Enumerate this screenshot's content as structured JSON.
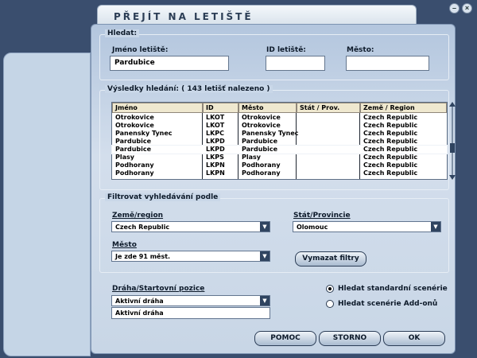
{
  "window": {
    "title": "PŘEJÍT NA LETIŠTĚ",
    "minimize": "–",
    "close": "×"
  },
  "search": {
    "group_title": "Hledat:",
    "airport_name_label": "Jméno letiště:",
    "airport_name_value": "Pardubice",
    "airport_id_label": "ID letiště:",
    "airport_id_value": "",
    "city_label": "Město:",
    "city_value": ""
  },
  "results": {
    "group_title": "Výsledky hledání: ( 143 letišť nalezeno )",
    "columns": [
      "Jméno",
      "ID",
      "Město",
      "Stát / Prov.",
      "Země / Region"
    ],
    "rows": [
      [
        "Otrokovice",
        "LKOT",
        "Otrokovice",
        "",
        "Czech Republic"
      ],
      [
        "Otrokovice",
        "LKOT",
        "Otrokovice",
        "",
        "Czech Republic"
      ],
      [
        "Panensky Tynec",
        "LKPC",
        "Panensky Tynec",
        "",
        "Czech Republic"
      ],
      [
        "Pardubice",
        "LKPD",
        "Pardubice",
        "",
        "Czech Republic"
      ],
      [
        "Pardubice",
        "LKPD",
        "Pardubice",
        "",
        "Czech Republic"
      ],
      [
        "Plasy",
        "LKPS",
        "Plasy",
        "",
        "Czech Republic"
      ],
      [
        "Podhorany",
        "LKPN",
        "Podhorany",
        "",
        "Czech Republic"
      ],
      [
        "Podhorany",
        "LKPN",
        "Podhorany",
        "",
        "Czech Republic"
      ]
    ]
  },
  "filter": {
    "group_title": "Filtrovat vyhledávání podle",
    "country_label": "Země/region",
    "country_value": "Czech Republic",
    "state_label": "Stát/Provincie",
    "state_value": "Olomouc",
    "city_label": "Město",
    "city_value": "Je zde 91 měst.",
    "clear_button": "Vymazat filtry"
  },
  "runway": {
    "label": "Dráha/Startovní pozice",
    "value": "Aktivní dráha",
    "list_item": "Aktivní dráha"
  },
  "scenery": {
    "option1": "Hledat standardní scenérie",
    "option2": "Hledat scenérie Add-onů",
    "selected": 1
  },
  "buttons": {
    "help": "POMOC",
    "cancel": "STORNO",
    "ok": "OK"
  },
  "colors": {
    "dialog_bg": "#c9d7e8",
    "header_bg": "#efe8cf",
    "button_border": "#2b3d56"
  }
}
